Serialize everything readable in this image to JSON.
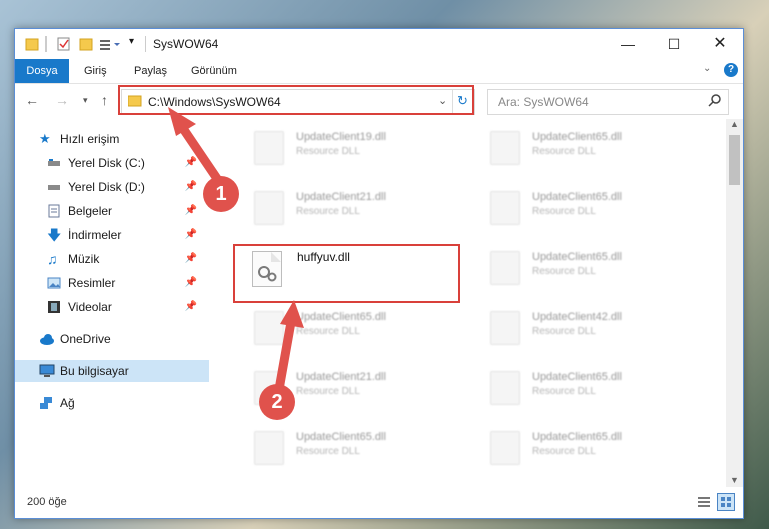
{
  "window": {
    "title": "SysWOW64"
  },
  "ribbon": {
    "tabs": [
      "Dosya",
      "Giriş",
      "Paylaş",
      "Görünüm"
    ]
  },
  "nav": {
    "address": "C:\\Windows\\SysWOW64",
    "search_placeholder": "Ara: SysWOW64"
  },
  "sidebar": {
    "items": [
      {
        "label": "Hızlı erişim",
        "icon": "star-icon"
      },
      {
        "label": "Yerel Disk (C:)",
        "icon": "drive-icon"
      },
      {
        "label": "Yerel Disk (D:)",
        "icon": "drive-icon"
      },
      {
        "label": "Belgeler",
        "icon": "document-icon"
      },
      {
        "label": "İndirmeler",
        "icon": "download-icon"
      },
      {
        "label": "Müzik",
        "icon": "music-icon"
      },
      {
        "label": "Resimler",
        "icon": "pictures-icon"
      },
      {
        "label": "Videolar",
        "icon": "video-icon"
      },
      {
        "label": "OneDrive",
        "icon": "cloud-icon"
      },
      {
        "label": "Bu bilgisayar",
        "icon": "computer-icon"
      },
      {
        "label": "Ağ",
        "icon": "network-icon"
      }
    ]
  },
  "files": {
    "col1": [
      {
        "name": "UpdateClient19.dll",
        "type": "Resource DLL"
      },
      {
        "name": "UpdateClient21.dll",
        "type": "Resource DLL"
      },
      {
        "name": "huffyuv.dll",
        "type": ""
      },
      {
        "name": "UpdateClient65.dll",
        "type": "Resource DLL"
      },
      {
        "name": "UpdateClient21.dll",
        "type": "Resource DLL"
      },
      {
        "name": "UpdateClient65.dll",
        "type": "Resource DLL"
      }
    ],
    "col2": [
      {
        "name": "UpdateClient65.dll",
        "type": "Resource DLL"
      },
      {
        "name": "UpdateClient65.dll",
        "type": "Resource DLL"
      },
      {
        "name": "UpdateClient65.dll",
        "type": "Resource DLL"
      },
      {
        "name": "UpdateClient42.dll",
        "type": "Resource DLL"
      },
      {
        "name": "UpdateClient65.dll",
        "type": "Resource DLL"
      },
      {
        "name": "UpdateClient65.dll",
        "type": "Resource DLL"
      }
    ]
  },
  "status": {
    "count": "200 öğe"
  },
  "annotations": {
    "step1": "1",
    "step2": "2",
    "color": "#d9403a"
  }
}
